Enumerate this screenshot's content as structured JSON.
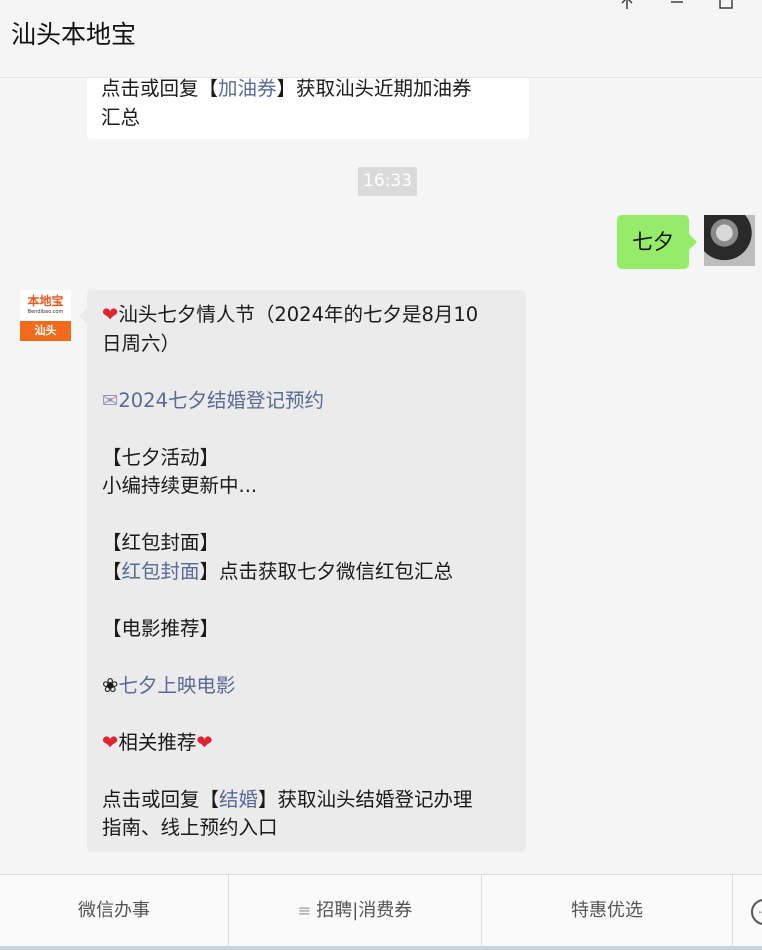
{
  "window": {
    "title": "汕头本地宝",
    "pin_icon": "pin-icon",
    "minimize_icon": "minimize-icon",
    "maximize_icon": "maximize-icon"
  },
  "chat": {
    "prev_message": {
      "line1_prefix": "点击或回复【",
      "line1_link": "加油券",
      "line1_suffix": "】获取汕头近期加油券",
      "line2": "汇总"
    },
    "timestamp": "16:33",
    "sent_message": "七夕",
    "bot_avatar": {
      "logo_text": "本地宝",
      "logo_sub": "Bendibao.com",
      "city": "汕头"
    },
    "reply": {
      "heart": "❤",
      "headline_line1": "汕头七夕情人节（2024年的七夕是8月10",
      "headline_line2": "日周六）",
      "mail_icon": "✉",
      "register_link": "2024七夕结婚登记预约",
      "activity_header": "【七夕活动】",
      "activity_text": "小编持续更新中...",
      "cover_header": "【红包封面】",
      "cover_open": "【",
      "cover_link": "红包封面",
      "cover_suffix": "】点击获取七夕微信红包汇总",
      "movie_header": "【电影推荐】",
      "flower_icon": "❀",
      "movie_link": "七夕上映电影",
      "related": "相关推荐",
      "marriage_prefix": "点击或回复【",
      "marriage_link": "结婚",
      "marriage_suffix": "】获取汕头结婚登记办理",
      "marriage_line2": "指南、线上预约入口"
    }
  },
  "bottom_menu": {
    "items": [
      {
        "label": "微信办事"
      },
      {
        "label": "招聘|消费券"
      },
      {
        "label": "特惠优选"
      }
    ]
  },
  "colors": {
    "sent_bubble": "#95ec69",
    "link": "#576b95",
    "brand_orange": "#f26b1d"
  }
}
